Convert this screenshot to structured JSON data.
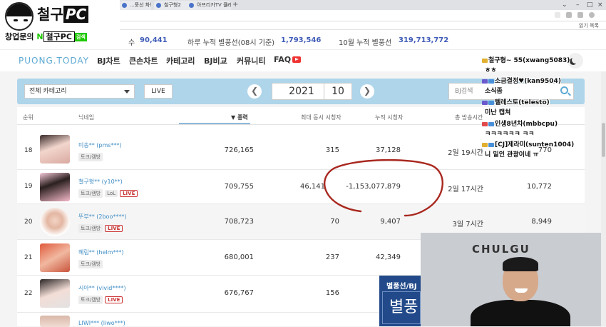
{
  "browser": {
    "tabs": [
      {
        "label": "...풍선 차트"
      },
      {
        "label": "철구형2"
      },
      {
        "label": "아프리카TV 플레이어"
      }
    ],
    "new_tab": "+",
    "bookmarks_label": "읽기 목록"
  },
  "stats": {
    "label1": "수",
    "value1": "90,441",
    "label2": "하루 누적 별풍선(08시 기준)",
    "value2": "1,793,546",
    "label3": "10월 누적 별풍선",
    "value3": "319,713,772"
  },
  "nav": {
    "logo": "PUONG.TODAY",
    "items": [
      "BJ차트",
      "큰손차트",
      "카테고리",
      "BJ비교",
      "커뮤니티",
      "FAQ"
    ]
  },
  "filter": {
    "category": "전체 카테고리",
    "live": "LIVE",
    "prev": "❮",
    "next": "❯",
    "year": "2021",
    "month": "10",
    "search_placeholder": "BJ검색"
  },
  "table": {
    "headers": [
      "순위",
      "닉네임",
      "▼ 풍력",
      "최대 동시 시청자",
      "누적 시청자",
      "총 방송시간"
    ],
    "rows": [
      {
        "rank": "18",
        "nick": "미송** (pms***)",
        "tags": [
          "토크/캠방"
        ],
        "live": false,
        "balloon": "726,165",
        "max_viewers": "315",
        "total_viewers": "37,128",
        "time": "2일 19시간",
        "extra": "770"
      },
      {
        "rank": "19",
        "nick": "철구형** (y10**)",
        "tags": [
          "토크/캠방",
          "LoL"
        ],
        "live": true,
        "balloon": "709,755",
        "max_viewers": "46,141",
        "total_viewers": "-1,153,077,879",
        "time": "2일 17시간",
        "extra": "10,772"
      },
      {
        "rank": "20",
        "nick": "뚜부** (2boo****)",
        "tags": [
          "토크/캠방"
        ],
        "live": true,
        "balloon": "708,723",
        "max_viewers": "70",
        "total_viewers": "9,407",
        "time": "3일 7시간",
        "extra": "8,949"
      },
      {
        "rank": "21",
        "nick": "혜림** (helm***)",
        "tags": [
          "토크/캠방"
        ],
        "live": false,
        "balloon": "680,001",
        "max_viewers": "237",
        "total_viewers": "42,349",
        "time": "",
        "extra": ""
      },
      {
        "rank": "22",
        "nick": "시아** (vivid****)",
        "tags": [
          "토크/캠방"
        ],
        "live": true,
        "balloon": "676,767",
        "max_viewers": "156",
        "total_viewers": "",
        "time": "",
        "extra": ""
      },
      {
        "rank": "",
        "nick": "LIWI*** (liwo***)",
        "tags": [],
        "live": false,
        "balloon": "",
        "max_viewers": "",
        "total_viewers": "",
        "time": "",
        "extra": ""
      }
    ],
    "live_label": "LIVE"
  },
  "overlay": {
    "logo_main": "철구",
    "logo_pc": "PC",
    "logo_sub_prefix": "창업문의",
    "logo_sub_n": "N",
    "logo_sub_box": "철구PC",
    "logo_sub_search": "검색",
    "chat": [
      "철구형~ 55(xwang5083)",
      "ㅎㅎ",
      "소금결정♥(kan9504)",
      "소식좀",
      "텔레스토(telesto)",
      "미난 캡쳐",
      "인생8년차(mbbcpu)",
      "ㅋㅋㅋㅋㅋㅋ ㅋㅋ",
      "[CJ]제라미(sunten1004)",
      "니 밑인 관광이네 ㅠ"
    ],
    "webcam_sign": "CHULGU",
    "popup_title": "별풍선/BJ",
    "popup_big": "별풍"
  },
  "colors": {
    "accent": "#3e5bb7",
    "filter_bg": "#aed5ea",
    "live_red": "#cc3333",
    "annotation_red": "#a8281f"
  }
}
